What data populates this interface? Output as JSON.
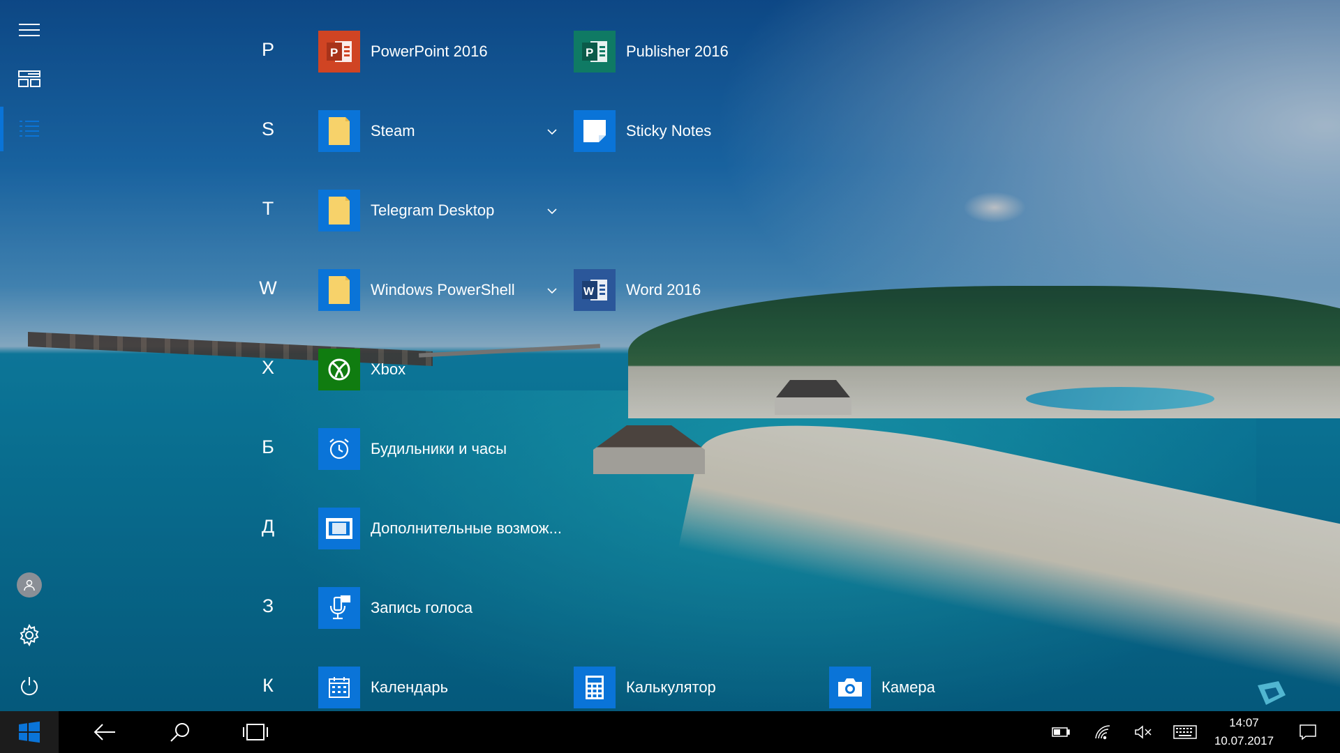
{
  "colors": {
    "accent": "#0a74d8",
    "tile_blue": "#0a74d8",
    "powerpoint": "#d04423",
    "publisher": "#0f7a64",
    "word": "#2b579a",
    "xbox": "#107c10",
    "folder": "#f7d26a",
    "taskbar": "#000000"
  },
  "rail": {
    "menu_icon": "hamburger-icon",
    "tiles_icon": "tiles-view-icon",
    "list_icon": "all-apps-list-icon",
    "user_icon": "user-avatar-icon",
    "settings_icon": "gear-icon",
    "power_icon": "power-icon"
  },
  "letters": [
    "P",
    "S",
    "T",
    "W",
    "X",
    "Б",
    "Д",
    "З",
    "К"
  ],
  "apps": {
    "powerpoint": "PowerPoint 2016",
    "publisher": "Publisher 2016",
    "steam": "Steam",
    "sticky_notes": "Sticky Notes",
    "telegram": "Telegram Desktop",
    "powershell": "Windows PowerShell",
    "word": "Word 2016",
    "xbox": "Xbox",
    "alarms": "Будильники и часы",
    "ease_of_access": "Дополнительные возмож...",
    "voice_recorder": "Запись голоса",
    "calendar": "Календарь",
    "calculator": "Калькулятор",
    "camera": "Камера"
  },
  "taskbar": {
    "start_icon": "windows-start-icon",
    "back_icon": "back-arrow-icon",
    "search_icon": "search-icon",
    "task_view_icon": "task-view-icon",
    "battery_icon": "battery-icon",
    "wifi_icon": "wifi-icon",
    "volume_icon": "volume-muted-icon",
    "keyboard_icon": "touch-keyboard-icon",
    "time": "14:07",
    "date": "10.07.2017",
    "notifications_icon": "action-center-icon"
  }
}
